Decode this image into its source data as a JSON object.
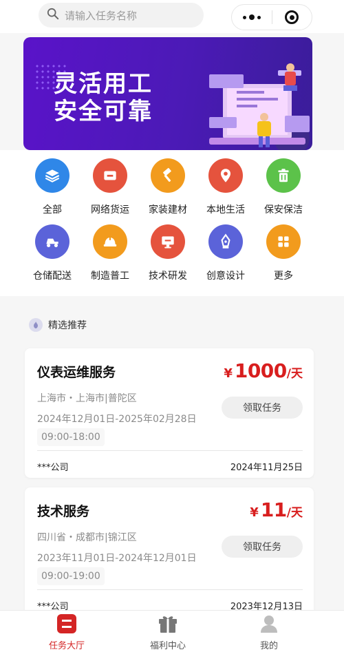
{
  "header": {
    "search_placeholder": "请输入任务名称",
    "search_icon": "search-icon",
    "menu_icon": "more-dots-icon",
    "close_icon": "close-circle-icon"
  },
  "banner": {
    "line1": "灵活用工",
    "line2": "安全可靠"
  },
  "categories": [
    {
      "label": "全部",
      "icon": "layers-icon",
      "color": "#2f87e8"
    },
    {
      "label": "网络货运",
      "icon": "minus-square-icon",
      "color": "#e5533d"
    },
    {
      "label": "家装建材",
      "icon": "hammer-icon",
      "color": "#f29b1d"
    },
    {
      "label": "本地生活",
      "icon": "location-pin-icon",
      "color": "#e5533d"
    },
    {
      "label": "保安保洁",
      "icon": "trash-icon",
      "color": "#5cc24a"
    },
    {
      "label": "仓储配送",
      "icon": "scooter-icon",
      "color": "#5b63d9"
    },
    {
      "label": "制造普工",
      "icon": "helmet-icon",
      "color": "#f29b1d"
    },
    {
      "label": "技术研发",
      "icon": "monitor-icon",
      "color": "#e5533d"
    },
    {
      "label": "创意设计",
      "icon": "pen-nib-icon",
      "color": "#5b63d9"
    },
    {
      "label": "更多",
      "icon": "grid-icon",
      "color": "#f29b1d"
    }
  ],
  "section": {
    "title": "精选推荐",
    "icon": "flame-icon"
  },
  "tasks": [
    {
      "name": "仪表运维服务",
      "currency": "¥",
      "price": "1000",
      "unit": "/天",
      "location": "上海市・上海市|普陀区",
      "date_range": "2024年12月01日-2025年02月28日",
      "hours": "09:00-18:00",
      "button": "领取任务",
      "company": "***公司",
      "published": "2024年11月25日"
    },
    {
      "name": "技术服务",
      "currency": "¥",
      "price": "11",
      "unit": "/天",
      "location": "四川省・成都市|锦江区",
      "date_range": "2023年11月01日-2024年12月01日",
      "hours": "09:00-19:00",
      "button": "领取任务",
      "company": "***公司",
      "published": "2023年12月13日"
    }
  ],
  "tabbar": {
    "items": [
      {
        "label": "任务大厅",
        "icon": "task-hall-icon",
        "active": true
      },
      {
        "label": "福利中心",
        "icon": "gift-icon",
        "active": false
      },
      {
        "label": "我的",
        "icon": "user-icon",
        "active": false
      }
    ]
  },
  "colors": {
    "accent": "#d42525",
    "banner": "#5a13c9"
  }
}
